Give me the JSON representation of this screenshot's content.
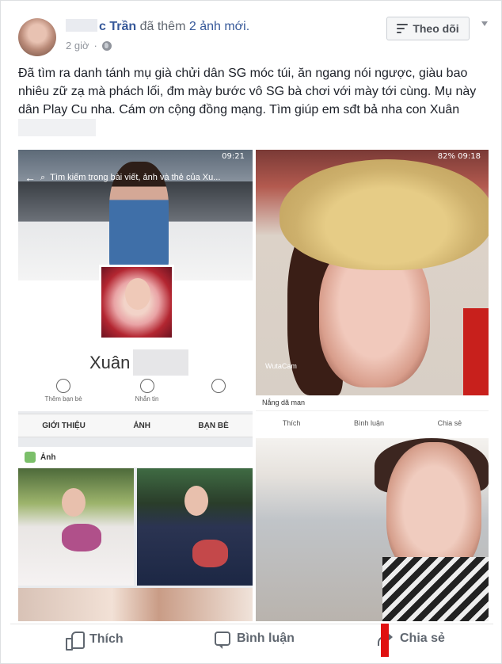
{
  "header": {
    "name": "c Trần",
    "action": "đã thêm",
    "added": "2 ảnh mới.",
    "time": "2 giờ",
    "follow_label": "Theo dõi"
  },
  "post": {
    "text": "Đã tìm ra danh tánh mụ già chửi dân SG móc túi, ăn ngang nói ngược, giàu bao nhiêu zữ zạ mà phách lối, đm mày bước vô SG bà chơi với mày tới cùng. Mụ này dân Play Cu nha. Cám ơn cộng đồng mạng. Tìm giúp em sđt bả nha con Xuân"
  },
  "photo_left": {
    "status_time": "09:21",
    "search_placeholder": "Tìm kiếm trong bài viết, ảnh và thẻ của Xu...",
    "profile_name": "Xuân",
    "action_add_friend": "Thêm bạn bè",
    "action_message": "Nhắn tin",
    "tab_about": "GIỚI THIỆU",
    "tab_photos": "ẢNH",
    "tab_friends": "BẠN BÈ",
    "photos_section": "Ảnh"
  },
  "photo_right_top": {
    "status": "82% 09:18",
    "watermark": "WutaCam",
    "caption": "Nắng dã man",
    "like": "Thích",
    "comment": "Bình luận",
    "share": "Chia sẻ"
  },
  "footer": {
    "like_label": "Thích",
    "comment_label": "Bình luận",
    "share_label": "Chia sẻ"
  },
  "colors": {
    "link_blue": "#365899",
    "gray_text": "#606770",
    "red_mark": "#e01010"
  }
}
